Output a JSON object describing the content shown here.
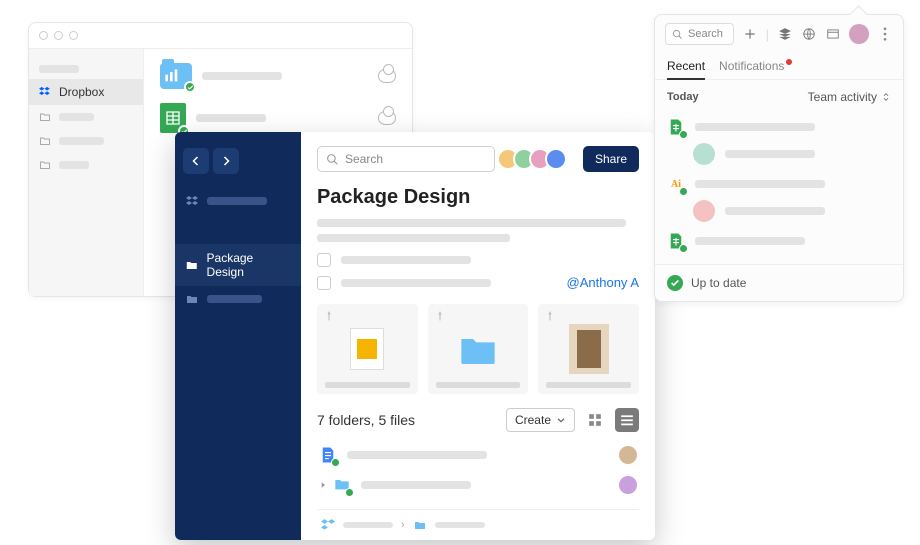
{
  "back_window": {
    "sidebar": {
      "dropbox_label": "Dropbox"
    }
  },
  "main": {
    "search_placeholder": "Search",
    "share_label": "Share",
    "title": "Package Design",
    "mention": "@Anthony A",
    "counts": "7 folders, 5 files",
    "create_label": "Create",
    "sidebar": {
      "package_design": "Package Design"
    }
  },
  "right_panel": {
    "search_placeholder": "Search",
    "tabs": {
      "recent": "Recent",
      "notifications": "Notifications"
    },
    "today_label": "Today",
    "team_activity_label": "Team activity",
    "status": "Up to date"
  },
  "colors": {
    "navy": "#0f2a5b",
    "green": "#34a853",
    "blue": "#1a73e8"
  }
}
